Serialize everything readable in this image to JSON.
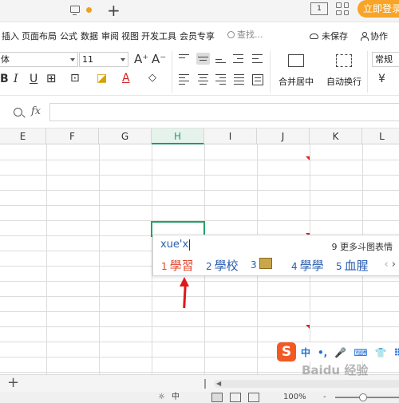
{
  "titlebar": {
    "login_label": "立即登录",
    "icon_1_label": "1"
  },
  "menu": {
    "items": [
      "插入",
      "页面布局",
      "公式",
      "数据",
      "审阅",
      "视图",
      "开发工具",
      "会员专享"
    ],
    "search_placeholder": "查找...",
    "unsaved_label": "未保存",
    "collab_label": "协作"
  },
  "toolbar": {
    "font_name": "体",
    "font_size": "11",
    "grow_font": "A⁺",
    "shrink_font": "A⁻",
    "bold": "B",
    "italic": "I",
    "underline": "U",
    "font_color_glyph": "A",
    "merge_label": "合并居中",
    "wrap_label": "自动换行",
    "number_format": "常规",
    "currency_glyph": "¥"
  },
  "formula": {
    "fx_label": "fx",
    "value": ""
  },
  "columns": [
    "E",
    "F",
    "G",
    "H",
    "I",
    "J",
    "K",
    "L"
  ],
  "active_column": "H",
  "ime": {
    "input": "xue'x",
    "more": "9 更多斗图表情",
    "candidates": [
      {
        "num": "1",
        "text": "學習"
      },
      {
        "num": "2",
        "text": "學校"
      },
      {
        "num": "3",
        "text": ""
      },
      {
        "num": "4",
        "text": "學學"
      },
      {
        "num": "5",
        "text": "血腥"
      }
    ],
    "prev": "‹",
    "next": "›"
  },
  "sogou": {
    "logo": "S",
    "items": [
      "中",
      "•,",
      "🎤",
      "⌨",
      "👕",
      "⠿"
    ]
  },
  "sheetbar": {
    "add_label": "+"
  },
  "statusbar": {
    "mode": "中",
    "zoom": "100%",
    "minus": "-"
  },
  "watermark": "Baidu 经验",
  "colors": {
    "accent": "#21a366",
    "login": "#f7a428",
    "ime_text": "#2a5db0",
    "ime_first": "#e0452a",
    "arrow": "#e01818",
    "sogou": "#f15a24"
  }
}
